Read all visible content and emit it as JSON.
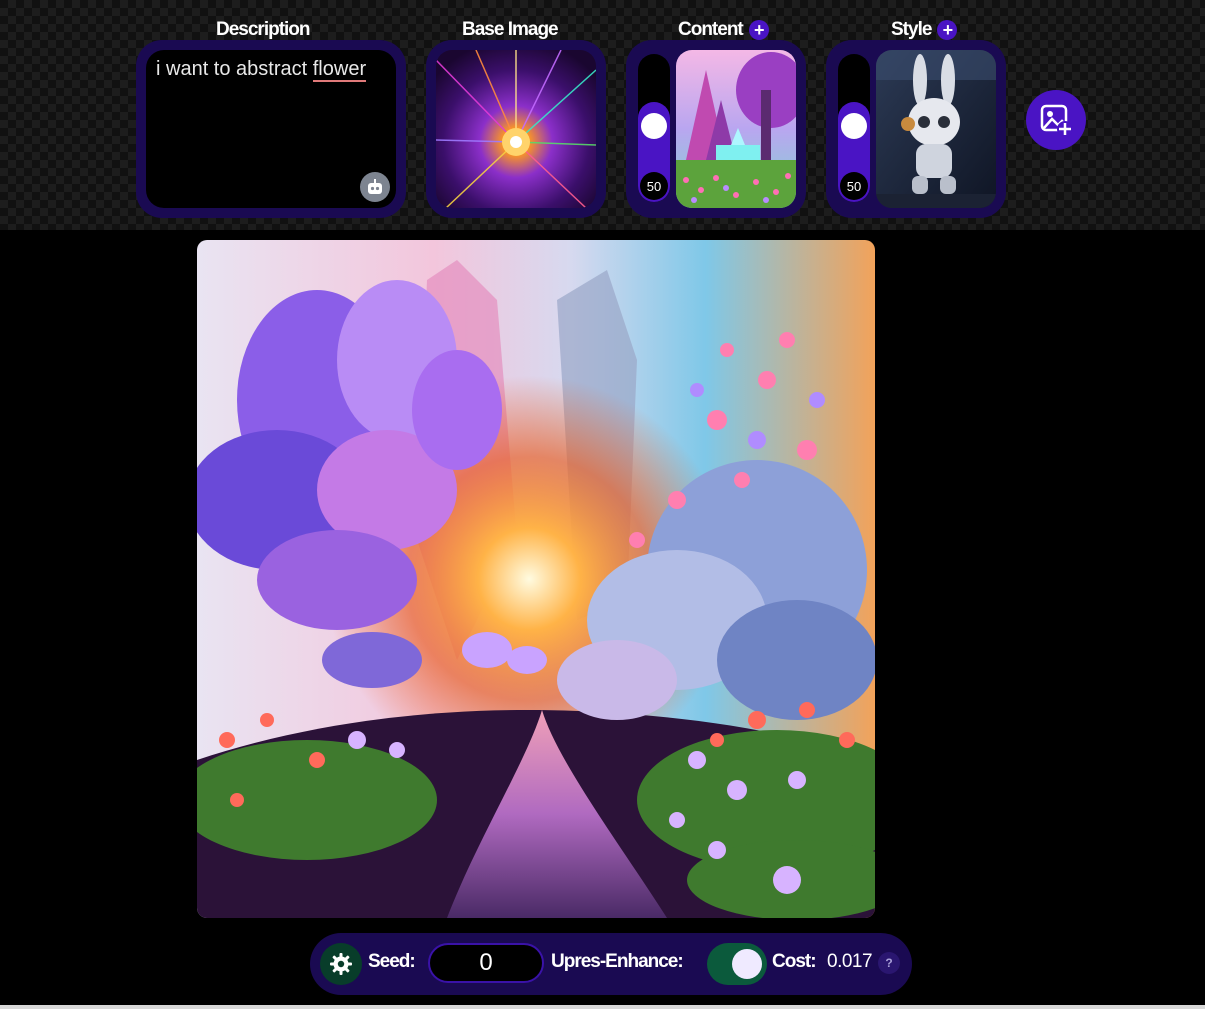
{
  "slots": {
    "description": {
      "label": "Description",
      "text_before": "i want to abstract ",
      "text_misspelled": "flower"
    },
    "base_image": {
      "label": "Base Image"
    },
    "content": {
      "label": "Content",
      "add_icon": "plus-icon",
      "strength": "50",
      "strength_fraction": 0.5
    },
    "style": {
      "label": "Style",
      "add_icon": "plus-icon",
      "strength": "50",
      "strength_fraction": 0.5
    }
  },
  "add_image_button": {
    "icon": "add-image-icon"
  },
  "bottom_bar": {
    "settings_icon": "gear-icon",
    "seed_label": "Seed:",
    "seed_value": "0",
    "upres_label": "Upres-Enhance:",
    "upres_enabled": true,
    "cost_label": "Cost:",
    "cost_value": "0.017",
    "help_label": "?"
  },
  "colors": {
    "accent": "#4a14c4",
    "panel": "#1a0a52",
    "toggle_on": "#0b5a3c",
    "settings_button": "#083d2a"
  }
}
